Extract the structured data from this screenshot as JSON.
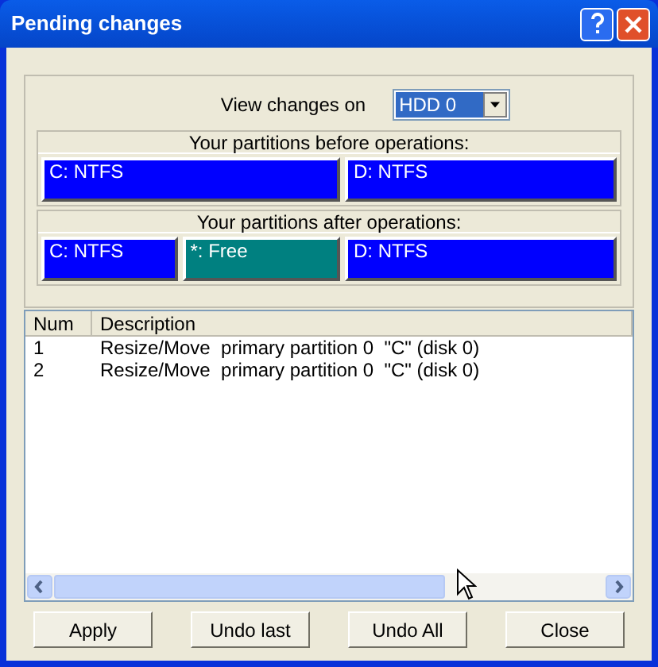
{
  "window": {
    "title": "Pending changes"
  },
  "view": {
    "label": "View changes on",
    "value": "HDD 0"
  },
  "before": {
    "title": "Your partitions before operations:",
    "partitions": [
      {
        "label": "C: NTFS",
        "color": "#0000ff"
      },
      {
        "label": "D: NTFS",
        "color": "#0000ff"
      }
    ]
  },
  "after": {
    "title": "Your partitions after operations:",
    "partitions": [
      {
        "label": "C: NTFS",
        "color": "#0000ff"
      },
      {
        "label": "*: Free",
        "color": "#008080"
      },
      {
        "label": "D: NTFS",
        "color": "#0000ff"
      }
    ]
  },
  "table": {
    "columns": [
      "Num",
      "Description"
    ],
    "rows": [
      [
        "1",
        "Resize/Move  primary partition 0  \"C\" (disk 0)"
      ],
      [
        "2",
        "Resize/Move  primary partition 0  \"C\" (disk 0)"
      ]
    ]
  },
  "buttons": [
    "Apply",
    "Undo last",
    "Undo All",
    "Close"
  ]
}
